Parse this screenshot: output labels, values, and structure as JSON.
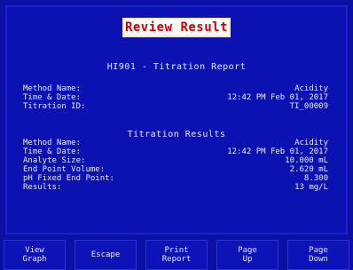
{
  "screen": {
    "title": "Review Result"
  },
  "report": {
    "title": "HI901 - Titration Report",
    "method": [
      {
        "label": "Method Name:",
        "value": "Acidity"
      },
      {
        "label": "Time & Date:",
        "value": "12:42 PM Feb 01, 2017"
      },
      {
        "label": "Titration ID:",
        "value": "TI_00009"
      }
    ],
    "results_title": "Titration Results",
    "results": [
      {
        "label": "Method Name:",
        "value": "Acidity"
      },
      {
        "label": "Time & Date:",
        "value": "12:42 PM Feb 01, 2017"
      },
      {
        "label": "Analyte Size:",
        "value": "10.000 mL"
      },
      {
        "label": "End Point Volume:",
        "value": "2.620 mL"
      },
      {
        "label": "pH Fixed End Point:",
        "value": "8.300"
      },
      {
        "label": "Results:",
        "value": "13 mg/L"
      }
    ]
  },
  "softkeys": [
    {
      "line1": "View",
      "line2": "Graph"
    },
    {
      "line1": "Escape",
      "line2": ""
    },
    {
      "line1": "Print",
      "line2": "Report"
    },
    {
      "line1": "Page",
      "line2": "Up"
    },
    {
      "line1": "Page",
      "line2": "Down"
    }
  ],
  "colors": {
    "background": "#0b10a3",
    "text": "#e8ecff",
    "title_bg": "#ffffff",
    "title_text": "#d10000"
  }
}
